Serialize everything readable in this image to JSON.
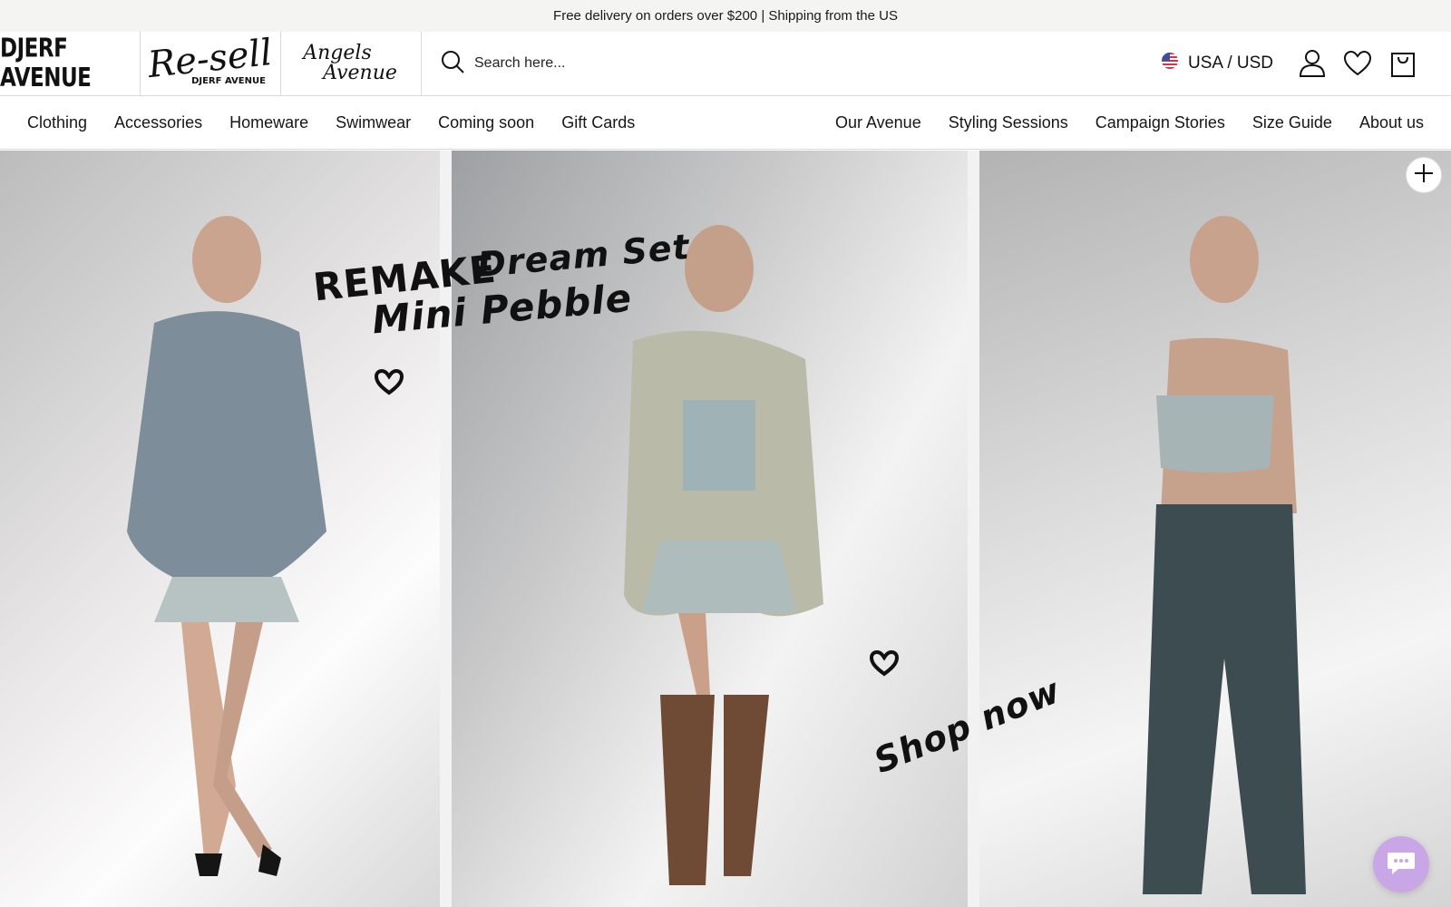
{
  "announcement": "Free delivery on orders over $200 | Shipping from the US",
  "brands": {
    "djerf": "DJERF AVENUE",
    "resell_script": "Re-sell",
    "resell_sub": "DJERF AVENUE",
    "angels_line1": "Angels",
    "angels_line2": "Avenue"
  },
  "search": {
    "placeholder": "Search here..."
  },
  "locale": {
    "label": "USA / USD",
    "flag_icon": "us-flag-icon"
  },
  "header_icons": [
    "account-icon",
    "wishlist-heart-icon",
    "cart-bag-icon"
  ],
  "nav": {
    "left": [
      "Clothing",
      "Accessories",
      "Homeware",
      "Swimwear",
      "Coming soon",
      "Gift Cards"
    ],
    "right": [
      "Our Avenue",
      "Styling Sessions",
      "Campaign Stories",
      "Size Guide",
      "About us"
    ]
  },
  "hero": {
    "handwriting": {
      "remake": "REMAKE",
      "dream_set": "Dream Set",
      "mini_pebble": "Mini Pebble",
      "shop_now": "Shop now"
    }
  },
  "colors": {
    "announcement_bg": "#f4f4f2",
    "chat_button": "#c9a7e6",
    "border": "#d9d9d9"
  }
}
